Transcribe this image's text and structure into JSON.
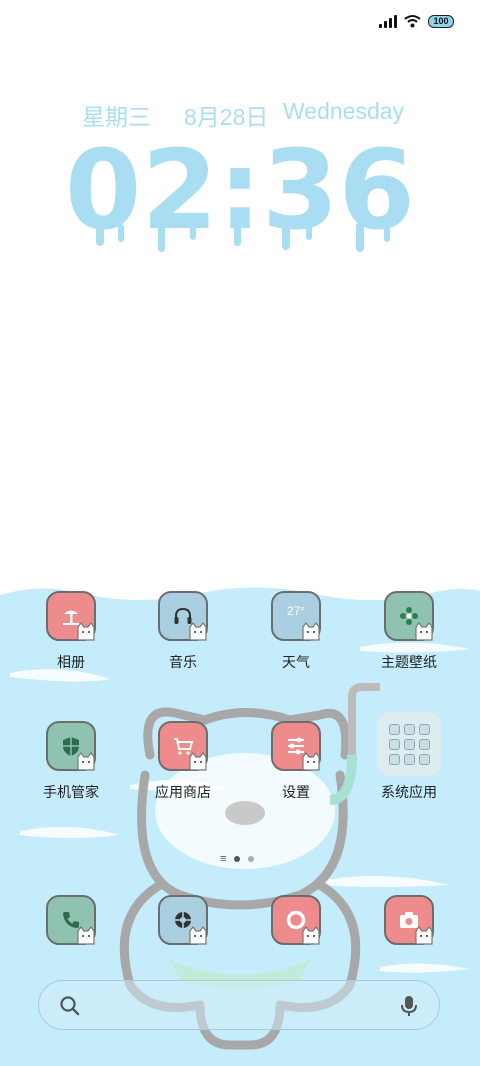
{
  "status": {
    "battery": "100"
  },
  "lockscreen": {
    "weekday_cn": "星期三",
    "date_cn": "8月28日",
    "weekday_en": "Wednesday",
    "time": "02:36"
  },
  "apps": [
    {
      "label": "相册"
    },
    {
      "label": "音乐"
    },
    {
      "label": "天气",
      "temp": "27°"
    },
    {
      "label": "主题壁纸"
    },
    {
      "label": "手机管家"
    },
    {
      "label": "应用商店"
    },
    {
      "label": "设置"
    },
    {
      "label": "系统应用"
    }
  ],
  "colors": {
    "accent": "#a9def2",
    "sea": "#c5ecfb",
    "pink": "#ee8b8c",
    "blue": "#a9cfe0",
    "green": "#8fc2b0"
  },
  "icons": [
    "signal-icon",
    "wifi-icon",
    "battery-icon",
    "search-icon",
    "mic-icon",
    "phone-icon",
    "browser-icon",
    "message-icon",
    "camera-icon"
  ]
}
